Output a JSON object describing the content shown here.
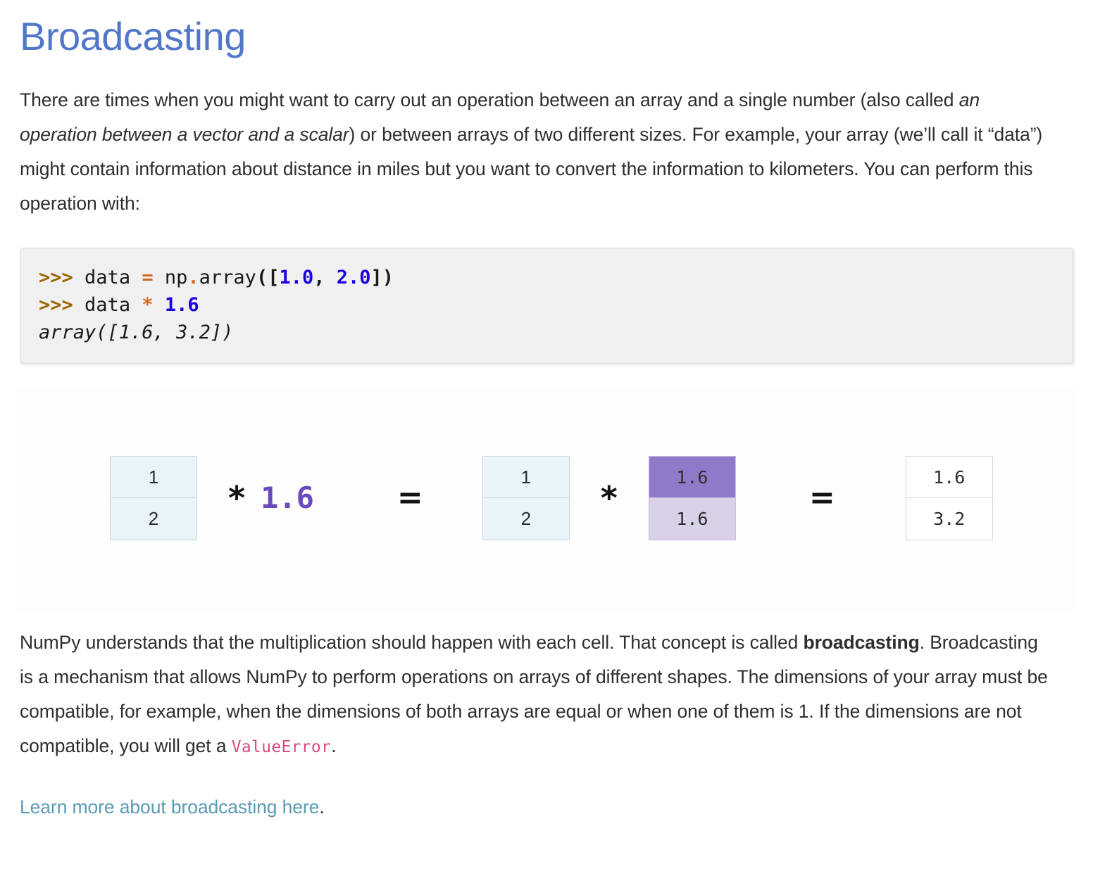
{
  "heading": "Broadcasting",
  "intro_paragraph": {
    "part1": "There are times when you might want to carry out an operation between an array and a single number (also called ",
    "emphasis": "an operation between a vector and a scalar",
    "part2": ") or between arrays of two different sizes. For example, your array (we’ll call it “data”) might contain information about distance in miles but you want to convert the information to kilometers. You can perform this operation with:"
  },
  "code_block": {
    "line1": {
      "prompt": ">>>",
      "var": "data",
      "equals": "=",
      "module": "np",
      "dot": ".",
      "func": "array",
      "open": "([",
      "num1": "1.0",
      "comma": ", ",
      "num2": "2.0",
      "close": "])"
    },
    "line2": {
      "prompt": ">>>",
      "var": "data",
      "star": "*",
      "num": "1.6"
    },
    "line3": "array([1.6, 3.2])"
  },
  "diagram": {
    "data_array": [
      "1",
      "2"
    ],
    "scalar": "1.6",
    "op_multiply": "*",
    "op_equals": "=",
    "data_array2": [
      "1",
      "2"
    ],
    "broadcast_array": [
      "1.6",
      "1.6"
    ],
    "result_array": [
      "1.6",
      "3.2"
    ],
    "colors": {
      "cell_blue": "#e8f4fa",
      "purple_dark": "#9179c9",
      "purple_light": "#d8d1e8",
      "scalar_purple": "#6a4bbd"
    }
  },
  "explain_paragraph": {
    "part1": "NumPy understands that the multiplication should happen with each cell. That concept is called ",
    "bold": "broadcasting",
    "part2": ". Broadcasting is a mechanism that allows NumPy to perform operations on arrays of different shapes. The dimensions of your array must be compatible, for example, when the dimensions of both arrays are equal or when one of them is 1. If the dimensions are not compatible, you will get a ",
    "code": "ValueError",
    "part3": "."
  },
  "footer_link": {
    "text": "Learn more about broadcasting here",
    "period": "."
  }
}
